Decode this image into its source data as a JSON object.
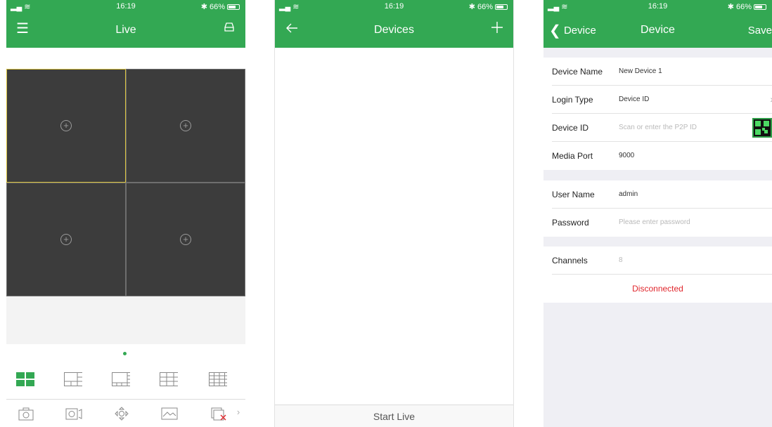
{
  "status": {
    "time": "16:19",
    "battery": "66%"
  },
  "live": {
    "title": "Live",
    "layouts": [
      "layout-4",
      "layout-6",
      "layout-8",
      "layout-9",
      "layout-16"
    ],
    "tools": [
      "capture-icon",
      "record-icon",
      "ptz-icon",
      "picture-icon",
      "close-all-icon"
    ]
  },
  "devices": {
    "title": "Devices",
    "start_live": "Start Live"
  },
  "device": {
    "back": "Device",
    "title": "Device",
    "save": "Save",
    "fields": {
      "device_name": {
        "label": "Device Name",
        "value": "New Device 1"
      },
      "login_type": {
        "label": "Login Type",
        "value": "Device ID"
      },
      "device_id": {
        "label": "Device ID",
        "placeholder": "Scan or enter the P2P ID"
      },
      "media_port": {
        "label": "Media Port",
        "value": "9000"
      },
      "user_name": {
        "label": "User Name",
        "value": "admin"
      },
      "password": {
        "label": "Password",
        "placeholder": "Please enter password"
      },
      "channels": {
        "label": "Channels",
        "value": "8"
      }
    },
    "connection_status": "Disconnected"
  },
  "colors": {
    "accent": "#33a853",
    "selected_border": "#d9c23e",
    "error": "#e0262c"
  }
}
